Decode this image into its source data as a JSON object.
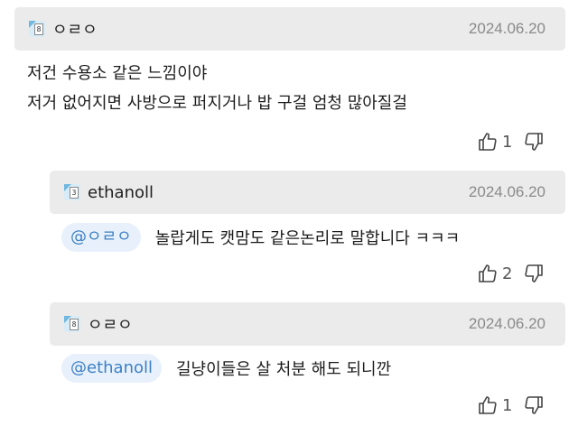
{
  "comments": [
    {
      "author": "ㅇㄹㅇ",
      "level": "8",
      "date": "2024.06.20",
      "lines": [
        "저건 수용소 같은 느낌이야",
        "저거 없어지면 사방으로 퍼지거나 밥 구걸 엄청 많아질걸"
      ],
      "likes": "1"
    },
    {
      "author": "ethanoll",
      "level": "3",
      "date": "2024.06.20",
      "mention": "@ㅇㄹㅇ",
      "text": "놀랍게도 캣맘도 같은논리로 말합니다 ㅋㅋㅋ",
      "likes": "2"
    },
    {
      "author": "ㅇㄹㅇ",
      "level": "8",
      "date": "2024.06.20",
      "mention": "@ethanoll",
      "text": "길냥이들은 살 처분 해도 되니깐",
      "likes": "1"
    }
  ],
  "icons": {
    "like": "thumbs-up-icon",
    "dislike": "thumbs-down-icon",
    "level": "level-badge-icon"
  },
  "colors": {
    "header_bg": "#ebebeb",
    "mention_bg": "#e8f1fb",
    "mention_text": "#3c80c4",
    "date": "#8a8a8a"
  }
}
